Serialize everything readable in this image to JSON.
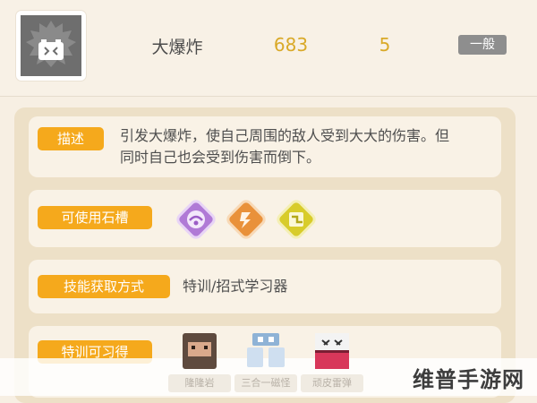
{
  "move": {
    "name": "大爆炸",
    "power": "683",
    "pp": "5",
    "category": "一般",
    "icon": "explosion-move-icon"
  },
  "description": {
    "label": "描述",
    "text_line1": "引发大爆炸，使自己周围的敌人受到大大的伤害。但",
    "text_line2": "同时自己也会受到伤害而倒下。"
  },
  "stone_slots": {
    "label": "可使用石槽",
    "slots": [
      {
        "icon": "purple-wave-stone-icon",
        "color": "#b07ad6"
      },
      {
        "icon": "orange-fire-stone-icon",
        "color": "#e9913a"
      },
      {
        "icon": "yellow-bolt-stone-icon",
        "color": "#d8cc2a"
      }
    ]
  },
  "acquisition": {
    "label": "技能获取方式",
    "text": "特训/招式学习器"
  },
  "trainable": {
    "label": "特训可习得",
    "pokemon": [
      {
        "name": "隆隆岩",
        "icon": "golem-cube-icon"
      },
      {
        "name": "三合一磁怪",
        "icon": "magneton-cube-icon"
      },
      {
        "name": "顽皮雷弹",
        "icon": "electrode-cube-icon"
      }
    ]
  },
  "watermark": "维普手游网"
}
